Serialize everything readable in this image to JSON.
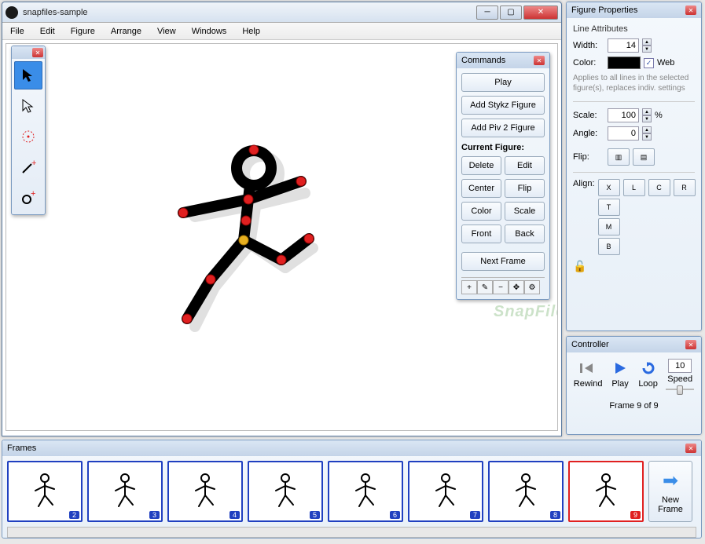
{
  "window": {
    "title": "snapfiles-sample"
  },
  "menubar": [
    "File",
    "Edit",
    "Figure",
    "Arrange",
    "View",
    "Windows",
    "Help"
  ],
  "commands": {
    "title": "Commands",
    "play": "Play",
    "add_stykz": "Add Stykz Figure",
    "add_piv2": "Add Piv 2 Figure",
    "current_label": "Current Figure:",
    "delete": "Delete",
    "edit": "Edit",
    "center": "Center",
    "flip": "Flip",
    "color": "Color",
    "scale": "Scale",
    "front": "Front",
    "back": "Back",
    "next_frame": "Next Frame"
  },
  "figure_props": {
    "title": "Figure Properties",
    "line_attrs": "Line Attributes",
    "width_label": "Width:",
    "width_value": "14",
    "color_label": "Color:",
    "color_value": "#000000",
    "web_label": "Web",
    "web_checked": true,
    "hint": "Applies to all lines in the selected figure(s), replaces indiv. settings",
    "scale_label": "Scale:",
    "scale_value": "100",
    "scale_unit": "%",
    "angle_label": "Angle:",
    "angle_value": "0",
    "flip_label": "Flip:",
    "align_label": "Align:",
    "align_x": "X",
    "align_l": "L",
    "align_c": "C",
    "align_r": "R",
    "align_t": "T",
    "align_m": "M",
    "align_b": "B"
  },
  "controller": {
    "title": "Controller",
    "rewind": "Rewind",
    "play": "Play",
    "loop": "Loop",
    "speed_label": "Speed",
    "speed_value": "10",
    "frame_status": "Frame 9 of 9"
  },
  "frames": {
    "title": "Frames",
    "items": [
      {
        "num": "2",
        "current": false
      },
      {
        "num": "3",
        "current": false
      },
      {
        "num": "4",
        "current": false
      },
      {
        "num": "5",
        "current": false
      },
      {
        "num": "6",
        "current": false
      },
      {
        "num": "7",
        "current": false
      },
      {
        "num": "8",
        "current": false
      },
      {
        "num": "9",
        "current": true
      }
    ],
    "new_frame": "New Frame"
  },
  "watermark": "SnapFiles"
}
